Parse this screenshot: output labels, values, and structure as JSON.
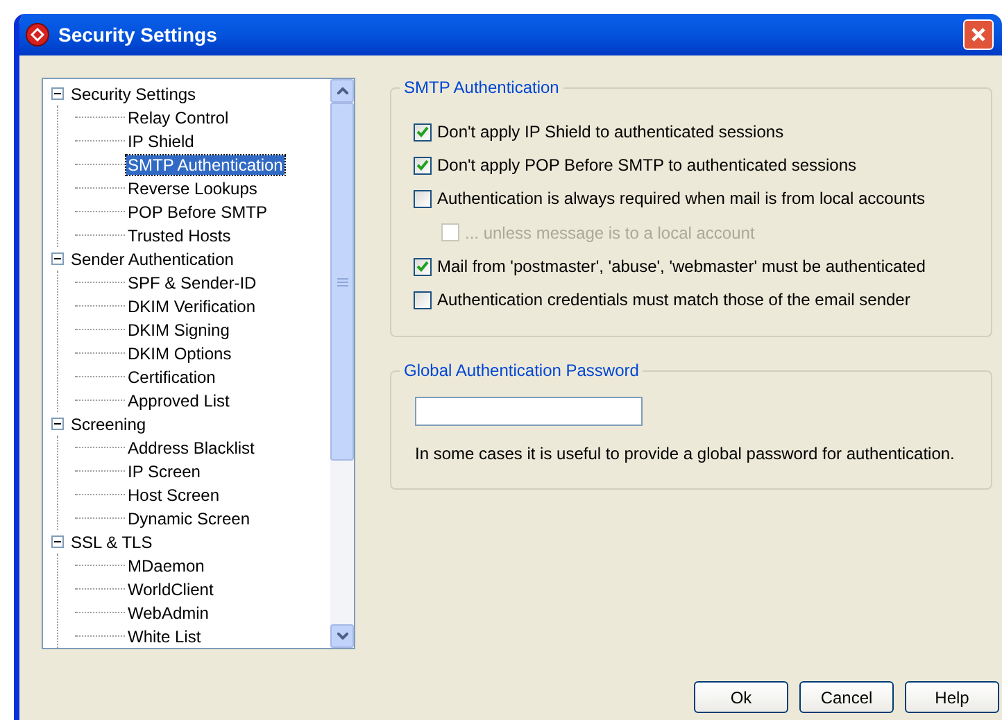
{
  "window": {
    "title": "Security Settings"
  },
  "tree": [
    {
      "label": "Security Settings",
      "expanded": true,
      "selected": false,
      "children": [
        {
          "label": "Relay Control",
          "selected": false
        },
        {
          "label": "IP Shield",
          "selected": false
        },
        {
          "label": "SMTP Authentication",
          "selected": true
        },
        {
          "label": "Reverse Lookups",
          "selected": false
        },
        {
          "label": "POP Before SMTP",
          "selected": false
        },
        {
          "label": "Trusted Hosts",
          "selected": false
        }
      ]
    },
    {
      "label": "Sender Authentication",
      "expanded": true,
      "selected": false,
      "children": [
        {
          "label": "SPF & Sender-ID",
          "selected": false
        },
        {
          "label": "DKIM Verification",
          "selected": false
        },
        {
          "label": "DKIM Signing",
          "selected": false
        },
        {
          "label": "DKIM Options",
          "selected": false
        },
        {
          "label": "Certification",
          "selected": false
        },
        {
          "label": "Approved List",
          "selected": false
        }
      ]
    },
    {
      "label": "Screening",
      "expanded": true,
      "selected": false,
      "children": [
        {
          "label": "Address Blacklist",
          "selected": false
        },
        {
          "label": "IP Screen",
          "selected": false
        },
        {
          "label": "Host Screen",
          "selected": false
        },
        {
          "label": "Dynamic Screen",
          "selected": false
        }
      ]
    },
    {
      "label": "SSL & TLS",
      "expanded": true,
      "selected": false,
      "children": [
        {
          "label": "MDaemon",
          "selected": false
        },
        {
          "label": "WorldClient",
          "selected": false
        },
        {
          "label": "WebAdmin",
          "selected": false
        },
        {
          "label": "White List",
          "selected": false
        }
      ]
    }
  ],
  "smtp_group": {
    "title": "SMTP Authentication",
    "options": [
      {
        "label": "Don't apply IP Shield to authenticated sessions",
        "checked": true,
        "disabled": false,
        "indented": false
      },
      {
        "label": "Don't apply POP Before SMTP to authenticated sessions",
        "checked": true,
        "disabled": false,
        "indented": false
      },
      {
        "label": "Authentication is always required when mail is from local accounts",
        "checked": false,
        "disabled": false,
        "indented": false
      },
      {
        "label": "... unless message is to a local account",
        "checked": false,
        "disabled": true,
        "indented": true
      },
      {
        "label": "Mail from 'postmaster', 'abuse', 'webmaster' must be authenticated",
        "checked": true,
        "disabled": false,
        "indented": false
      },
      {
        "label": "Authentication credentials must match those of the email sender",
        "checked": false,
        "disabled": false,
        "indented": false
      }
    ]
  },
  "password_group": {
    "title": "Global Authentication Password",
    "note": "In some cases it is useful to provide a global password for authentication."
  },
  "buttons": [
    "Ok",
    "Cancel",
    "Help"
  ]
}
